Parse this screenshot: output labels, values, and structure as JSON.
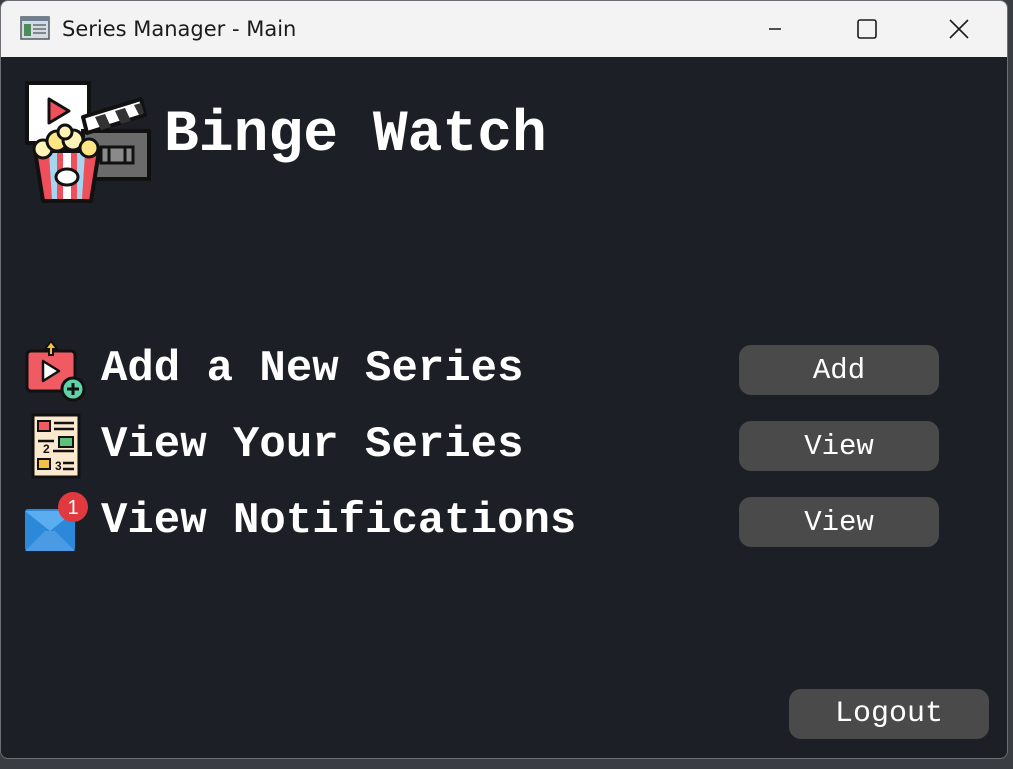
{
  "window": {
    "title": "Series Manager - Main",
    "controls": {
      "minimize": "minimize-icon",
      "maximize": "maximize-icon",
      "close": "close-icon"
    }
  },
  "header": {
    "logo_icon": "clapperboard-popcorn-icon",
    "brand": "Binge Watch"
  },
  "menu": {
    "items": [
      {
        "icon": "add-video-icon",
        "label": "Add a New Series",
        "button": "Add"
      },
      {
        "icon": "list-icon",
        "label": "View Your Series",
        "button": "View"
      },
      {
        "icon": "mail-notification-icon",
        "label": "View Notifications",
        "button": "View",
        "badge": "1"
      }
    ]
  },
  "footer": {
    "logout": "Logout"
  },
  "colors": {
    "background": "#1c1f25",
    "titlebar": "#f3f3f3",
    "button": "#4a4a4a",
    "text": "#ffffff",
    "badge": "#e0393e"
  }
}
